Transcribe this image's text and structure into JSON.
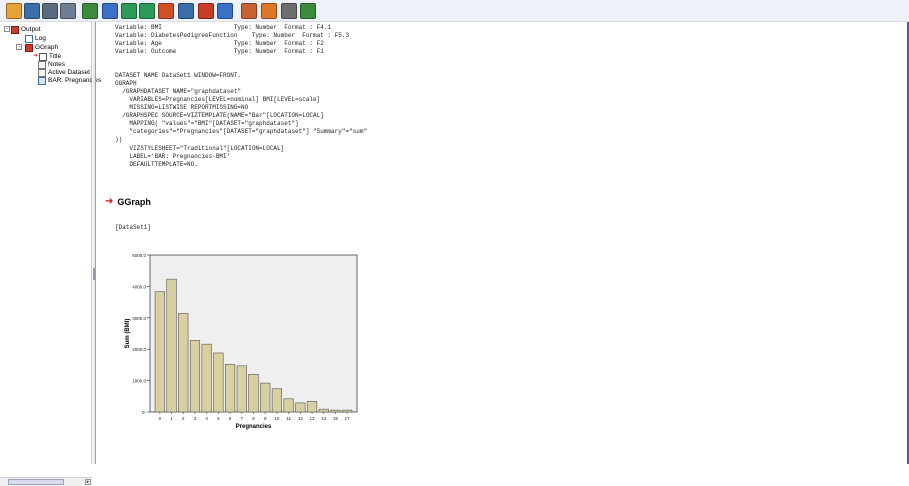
{
  "toolbar": {
    "buttons": [
      {
        "name": "open-icon",
        "color": "#e8a23a"
      },
      {
        "name": "save-icon",
        "color": "#3a6ea8"
      },
      {
        "name": "print-icon",
        "color": "#5a6a80"
      },
      {
        "name": "print-preview-icon",
        "color": "#6e7e95"
      },
      {
        "name": "export-icon",
        "color": "#3c8c3c"
      },
      {
        "name": "recall-dialog-icon",
        "color": "#3a70c8"
      },
      {
        "name": "undo-icon",
        "color": "#2d9a58"
      },
      {
        "name": "redo-icon",
        "color": "#2d9a58"
      },
      {
        "name": "goto-case-icon",
        "color": "#d25028"
      },
      {
        "name": "goto-variable-icon",
        "color": "#3a6ea8"
      },
      {
        "name": "chart-builder-icon",
        "color": "#c83c28"
      },
      {
        "name": "data-table-icon",
        "color": "#3a70c8"
      },
      {
        "name": "run-script-icon",
        "color": "#c86432"
      },
      {
        "name": "script-icon",
        "color": "#dc7828"
      },
      {
        "name": "designate-window-icon",
        "color": "#6e6e6e"
      },
      {
        "name": "insert-item-icon",
        "color": "#3c8c3c"
      }
    ]
  },
  "outline": {
    "items": [
      {
        "label": "Output",
        "icon": "output-book-icon"
      },
      {
        "label": "Log",
        "icon": "log-icon"
      },
      {
        "label": "GGraph",
        "icon": "ggraph-book-icon"
      },
      {
        "label": "Title",
        "icon": "title-icon"
      },
      {
        "label": "Notes",
        "icon": "notes-icon"
      },
      {
        "label": "Active Dataset",
        "icon": "active-dataset-icon"
      },
      {
        "label": "BAR: Pregnancies",
        "icon": "bar-chart-icon"
      }
    ]
  },
  "log": {
    "lines": [
      "Variable: BMI                    Type: Number  Format : F4.1",
      "Variable: DiabetesPedigreeFunction    Type: Number  Format : F5.3",
      "Variable: Age                    Type: Number  Format : F2",
      "Variable: Outcome                Type: Number  Format : F1",
      "",
      "DATASET NAME DataSet1 WINDOW=FRONT.",
      "GGRAPH",
      "  /GRAPHDATASET NAME=\"graphdataset\"",
      "    VARIABLES=Pregnancies[LEVEL=nominal] BMI[LEVEL=scale]",
      "    MISSING=LISTWISE REPORTMISSING=NO",
      "  /GRAPHSPEC SOURCE=VIZTEMPLATE(NAME=\"Bar\"[LOCATION=LOCAL]",
      "    MAPPING( \"values\"=\"BMI\"[DATASET=\"graphdataset\"]",
      "    \"categories\"=\"Pregnancies\"[DATASET=\"graphdataset\"] \"Summary\"=\"sum\"",
      "))",
      "    VIZSTYLESHEET=\"Traditional\"[LOCATION=LOCAL]",
      "    LABEL='BAR: Pregnancies-BMI'",
      "    DEFAULTTEMPLATE=NO."
    ]
  },
  "section": {
    "title": "GGraph",
    "dataset_label": "[DataSet1]"
  },
  "chart_data": {
    "type": "bar",
    "categories": [
      "0",
      "1",
      "2",
      "3",
      "4",
      "5",
      "6",
      "7",
      "8",
      "9",
      "10",
      "11",
      "12",
      "13",
      "14",
      "15",
      "17"
    ],
    "values": [
      3830,
      4230,
      3140,
      2280,
      2160,
      1880,
      1520,
      1470,
      1200,
      920,
      740,
      420,
      290,
      340,
      90,
      60,
      60
    ],
    "xlabel": "Pregnancies",
    "ylabel": "Sum (BMI)",
    "ylim": [
      0,
      5000
    ],
    "yticks": [
      0,
      1000,
      2000,
      3000,
      4000,
      5000
    ],
    "ytick_labels": [
      "0-",
      "1000.0",
      "2000.0",
      "3000.0",
      "4000.0",
      "5000.0"
    ],
    "bar_color": "#d8d0a0",
    "bar_edge_color": "#555555",
    "plot_background": "#efefef",
    "grid": false
  }
}
